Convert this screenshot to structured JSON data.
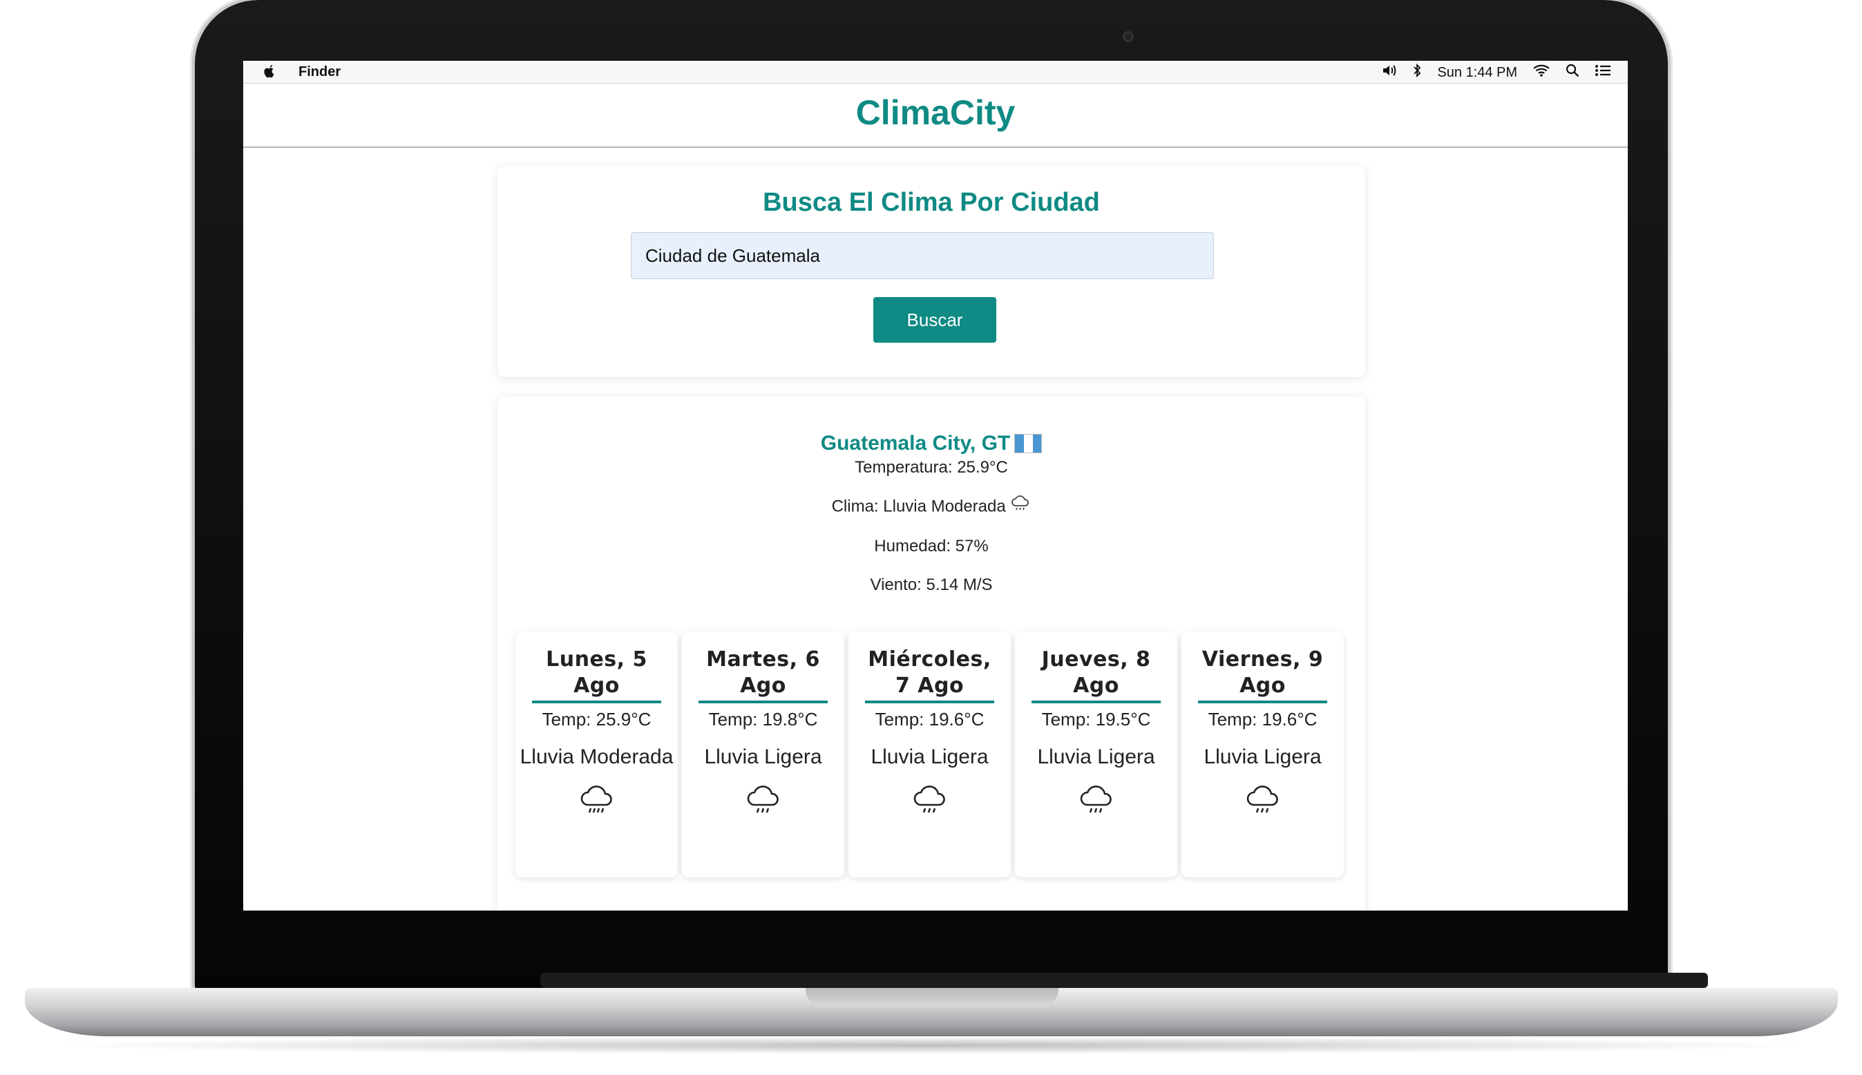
{
  "os_menubar": {
    "app_name": "Finder",
    "time": "Sun 1:44 PM"
  },
  "app": {
    "title": "ClimaCity"
  },
  "search": {
    "heading": "Busca El Clima Por Ciudad",
    "input_value": "Ciudad de Guatemala",
    "button_label": "Buscar"
  },
  "current": {
    "city": "Guatemala City, GT",
    "temperature": "Temperatura: 25.9°C",
    "condition": "Clima: Lluvia Moderada",
    "humidity": "Humedad: 57%",
    "wind": "Viento: 5.14 M/S"
  },
  "forecast": [
    {
      "date": "Lunes, 5 Ago",
      "temp": "Temp: 25.9°C",
      "desc": "Lluvia Moderada"
    },
    {
      "date": "Martes, 6 Ago",
      "temp": "Temp: 19.8°C",
      "desc": "Lluvia Ligera"
    },
    {
      "date": "Miércoles, 7 Ago",
      "temp": "Temp: 19.6°C",
      "desc": "Lluvia Ligera"
    },
    {
      "date": "Jueves, 8 Ago",
      "temp": "Temp: 19.5°C",
      "desc": "Lluvia Ligera"
    },
    {
      "date": "Viernes, 9 Ago",
      "temp": "Temp: 19.6°C",
      "desc": "Lluvia Ligera"
    }
  ],
  "icons": {
    "weather": "rain-cloud-icon",
    "flag": "guatemala-flag-icon"
  },
  "colors": {
    "accent": "#0f8a84",
    "input_bg": "#e8f0fd"
  }
}
